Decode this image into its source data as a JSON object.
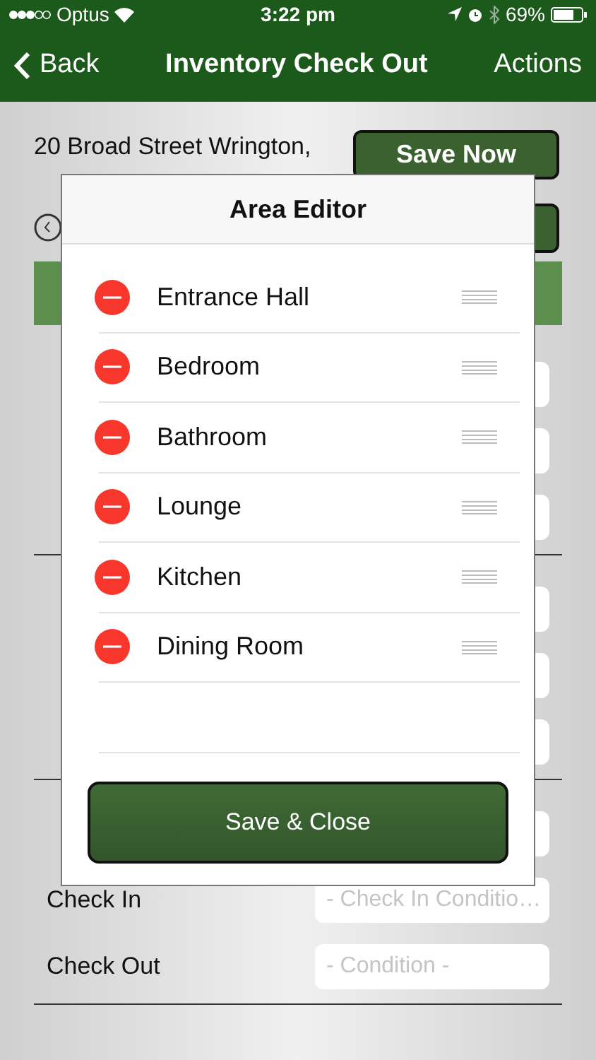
{
  "status_bar": {
    "carrier": "Optus",
    "time": "3:22 pm",
    "battery": "69%"
  },
  "nav_bar": {
    "back": "Back",
    "title": "Inventory Check Out",
    "action": "Actions"
  },
  "property": {
    "address": "20 Broad Street Wrington,",
    "save_button": "Save Now"
  },
  "condition_rows": [
    {
      "label": "Check In",
      "placeholder": "- Check In Conditio…"
    },
    {
      "label": "Check Out",
      "placeholder": "- Condition -"
    }
  ],
  "area_editor": {
    "title": "Area Editor",
    "areas": [
      "Entrance Hall",
      "Bedroom",
      "Bathroom",
      "Lounge",
      "Kitchen",
      "Dining Room"
    ],
    "save_button": "Save & Close"
  }
}
